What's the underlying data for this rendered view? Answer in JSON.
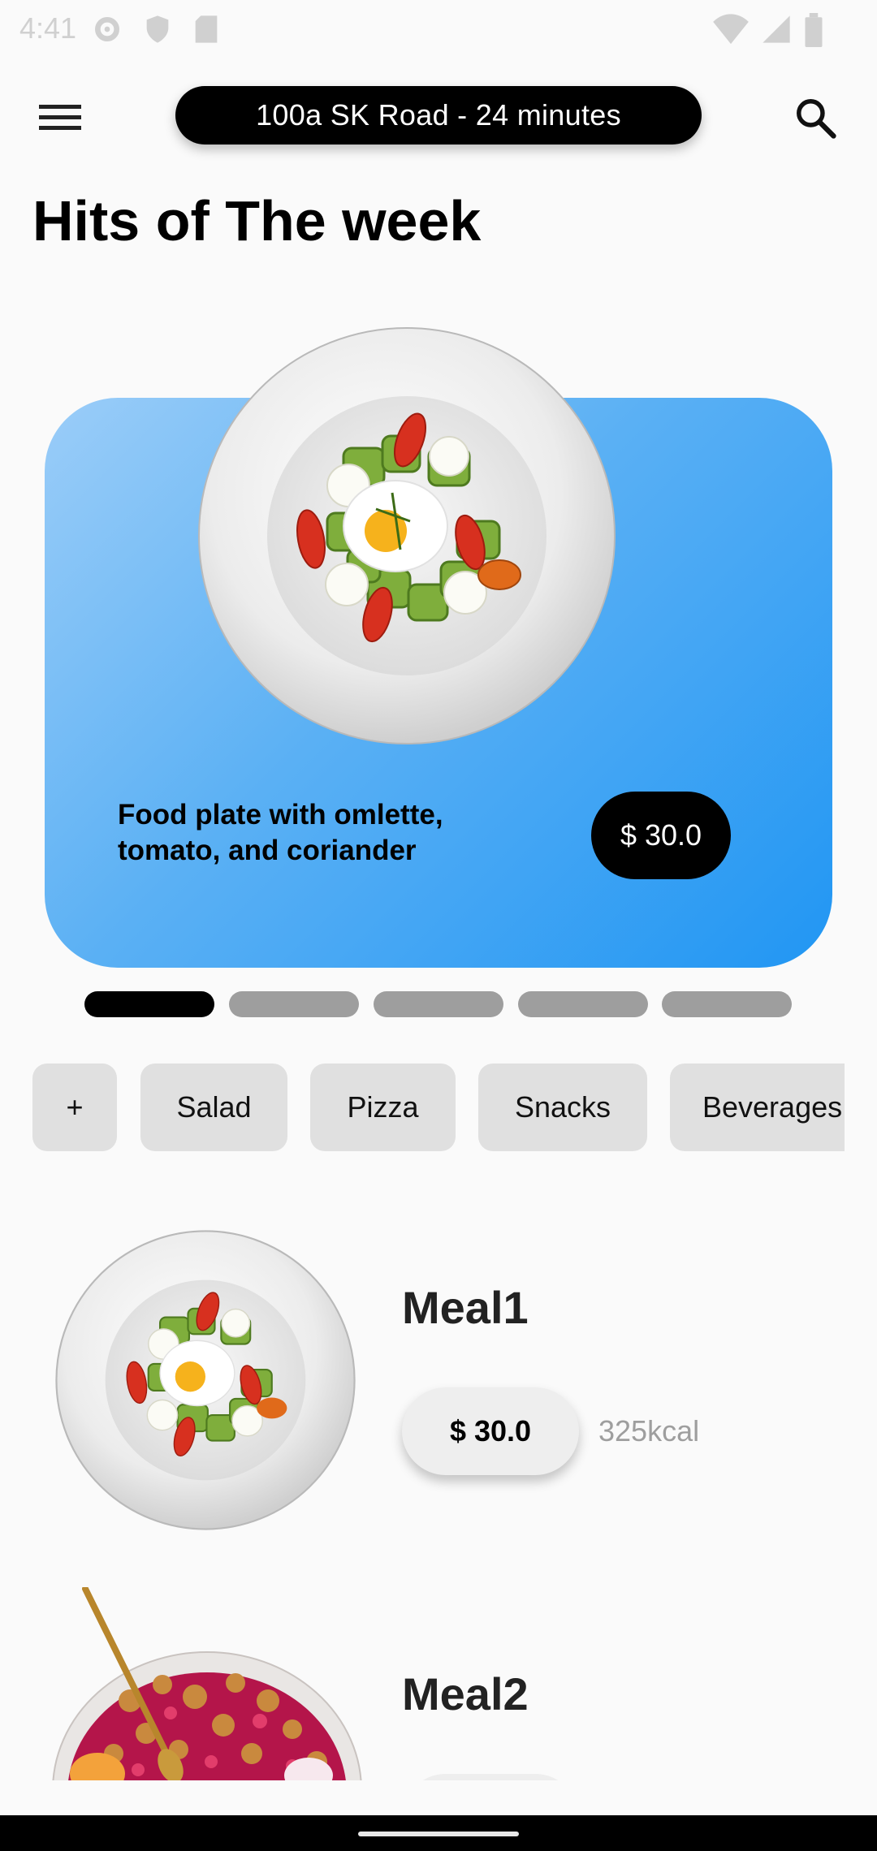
{
  "status_bar": {
    "time": "4:41",
    "icons": [
      "settings-icon",
      "shield-icon",
      "sd-card-icon",
      "wifi-icon",
      "signal-icon",
      "battery-icon"
    ]
  },
  "app_bar": {
    "menu_icon": "hamburger-menu-icon",
    "address": "100a SK Road - 24 minutes",
    "search_icon": "search-icon"
  },
  "page": {
    "title": "Hits of The week"
  },
  "hero": {
    "caption": "Food plate with omlette, tomato, and coriander",
    "price": "$ 30.0",
    "indicators": {
      "count": 5,
      "active": 0
    }
  },
  "categories": [
    "+",
    "Salad",
    "Pizza",
    "Snacks",
    "Beverages"
  ],
  "meals": [
    {
      "name": "Meal1",
      "price": "$ 30.0",
      "kcal": "325kcal"
    },
    {
      "name": "Meal2"
    }
  ],
  "colors": {
    "accent_gradient_start": "#9bcdf8",
    "accent_gradient_end": "#2196f3",
    "pill_dark": "#000000",
    "chip_bg": "#e0e0e0",
    "kcal_text": "#9e9e9e"
  }
}
